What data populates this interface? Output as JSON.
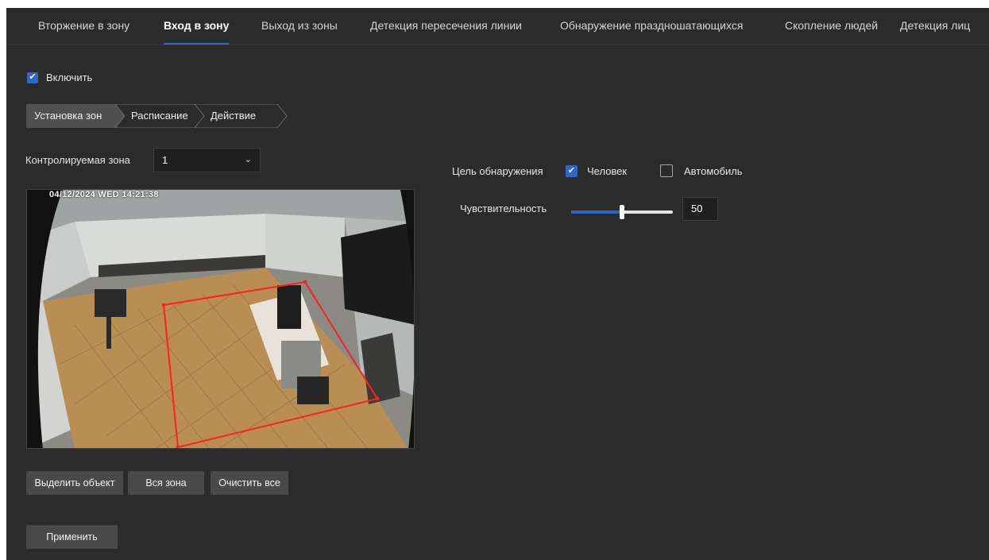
{
  "tabs": [
    {
      "label": "Вторжение в зону",
      "active": false
    },
    {
      "label": "Вход в зону",
      "active": true
    },
    {
      "label": "Выход из зоны",
      "active": false
    },
    {
      "label": "Детекция пересечения линии",
      "active": false
    },
    {
      "label": "Обнаружение праздношатающихся",
      "active": false
    },
    {
      "label": "Скопление людей",
      "active": false
    },
    {
      "label": "Детекция лиц",
      "active": false
    }
  ],
  "enable": {
    "label": "Включить",
    "checked": true
  },
  "steps": [
    "Установка зон",
    "Расписание",
    "Действие"
  ],
  "zone": {
    "label": "Контролируемая зона",
    "selected": "1"
  },
  "camera": {
    "osd_text": "04/12/2024 WED 14:21:38"
  },
  "buttons": {
    "select_object": "Выделить объект",
    "whole_zone": "Вся зона",
    "clear_all": "Очистить все",
    "apply": "Применить"
  },
  "detection": {
    "label": "Цель обнаружения",
    "targets": [
      {
        "label": "Человек",
        "checked": true
      },
      {
        "label": "Автомобиль",
        "checked": false
      }
    ]
  },
  "sensitivity": {
    "label": "Чувствительность",
    "value": "50",
    "fraction": 0.5
  },
  "colors": {
    "accent": "#2f66c8",
    "zone_line": "#ff2020",
    "background": "#2b2b2b"
  }
}
